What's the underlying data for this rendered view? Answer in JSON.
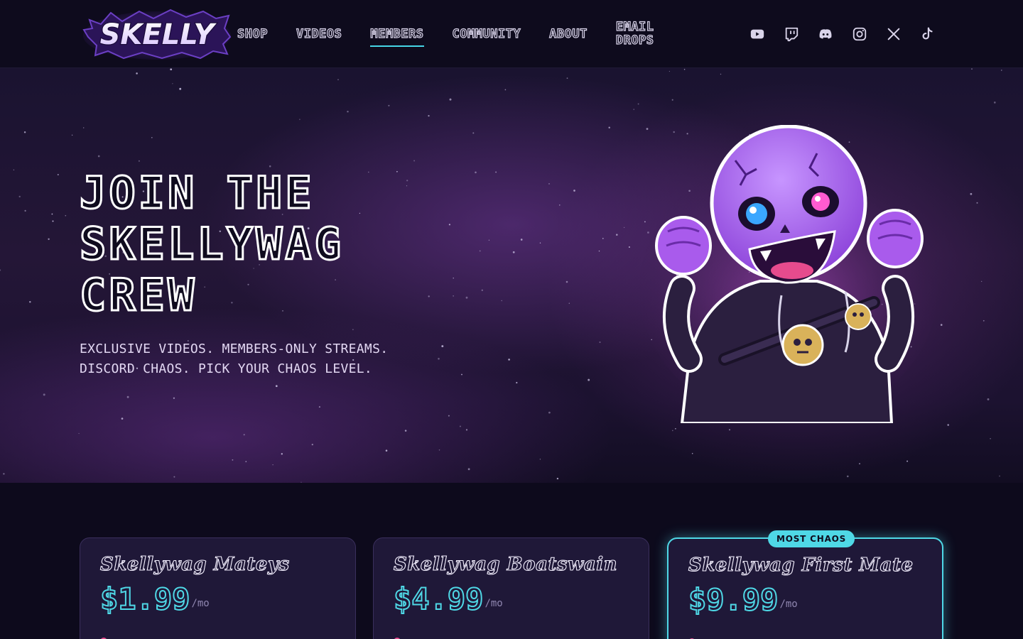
{
  "brand": {
    "logo_text": "SKELLY"
  },
  "nav": {
    "links": [
      {
        "label": "SHOP"
      },
      {
        "label": "VIDEOS"
      },
      {
        "label": "MEMBERS",
        "active": true
      },
      {
        "label": "COMMUNITY"
      },
      {
        "label": "ABOUT"
      },
      {
        "label": "EMAIL DROPS"
      }
    ],
    "socials": [
      "youtube-icon",
      "twitch-icon",
      "discord-icon",
      "instagram-icon",
      "x-icon",
      "tiktok-icon"
    ]
  },
  "hero": {
    "title_line1": "JOIN THE",
    "title_line2": "SKELLYWAG",
    "title_line3": "CREW",
    "subtitle_line1": "EXCLUSIVE VIDEOS. MEMBERS-ONLY STREAMS.",
    "subtitle_line2": "DISCORD CHAOS. PICK YOUR CHAOS LEVEL."
  },
  "plans": [
    {
      "name": "Skellywag Mateys",
      "price": "$1.99",
      "period": "/mo"
    },
    {
      "name": "Skellywag Boatswain",
      "price": "$4.99",
      "period": "/mo"
    },
    {
      "name": "Skellywag First Mate",
      "price": "$9.99",
      "period": "/mo",
      "badge": "MOST CHAOS"
    }
  ],
  "colors": {
    "accent": "#4fd8e6",
    "background": "#0d0a1c",
    "card": "#1f1838",
    "purple": "#a86be0"
  }
}
